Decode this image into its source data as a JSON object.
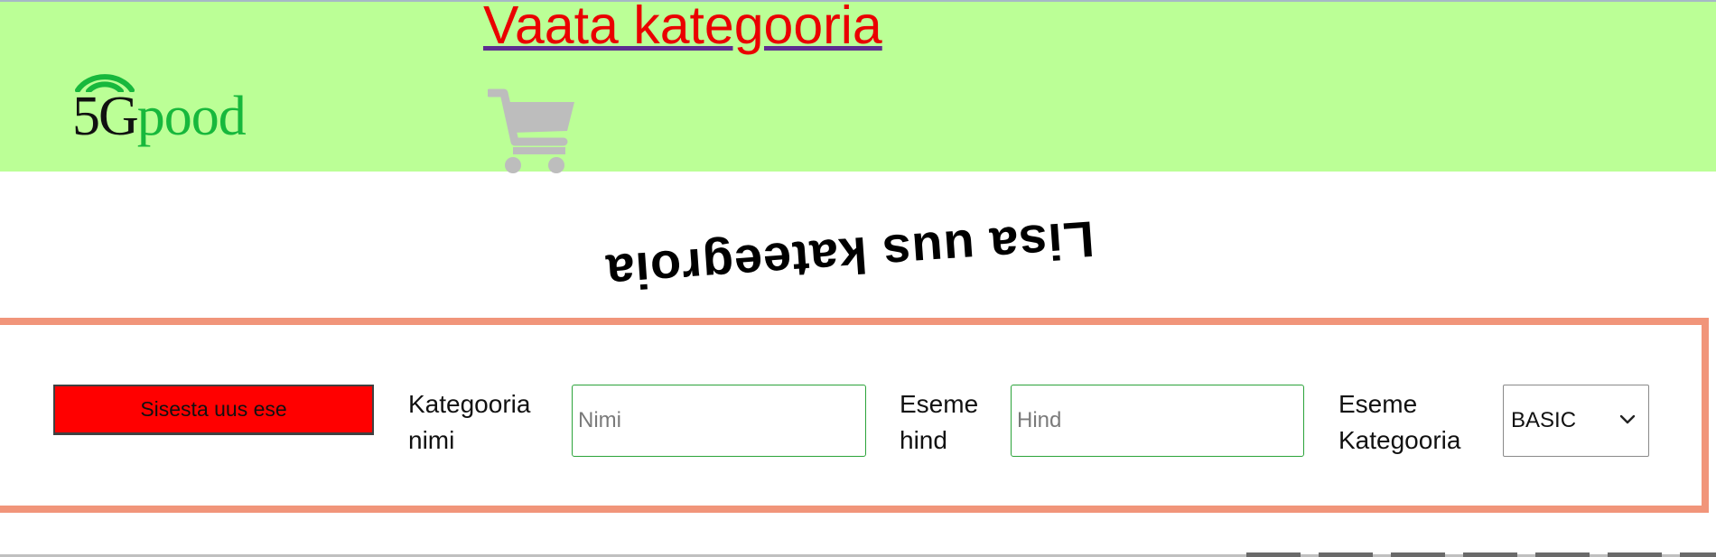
{
  "header": {
    "logo": {
      "brand_number": "5G",
      "brand_word": "pood",
      "brand_color": "#17b83c",
      "icon": "wifi-signal-icon"
    },
    "nav_link_label": "Vaata kategooria",
    "cart_icon": "shopping-cart-icon",
    "background_color": "#bbff96"
  },
  "main": {
    "heading": "Lisa uus kateegroia",
    "form": {
      "submit_label": "Sisesta uus ese",
      "name_label": "Kategooria nimi",
      "name_placeholder": "Nimi",
      "name_value": "",
      "price_label": "Eseme hind",
      "price_placeholder": "Hind",
      "price_value": "",
      "category_label": "Eseme Kategooria",
      "category_selected": "BASIC",
      "category_chevron_icon": "chevron-down-icon"
    },
    "colors": {
      "panel_border": "#f1957a",
      "submit_background": "#ff0000",
      "input_border": "#2ba33a",
      "link_text": "#ea0000"
    }
  }
}
